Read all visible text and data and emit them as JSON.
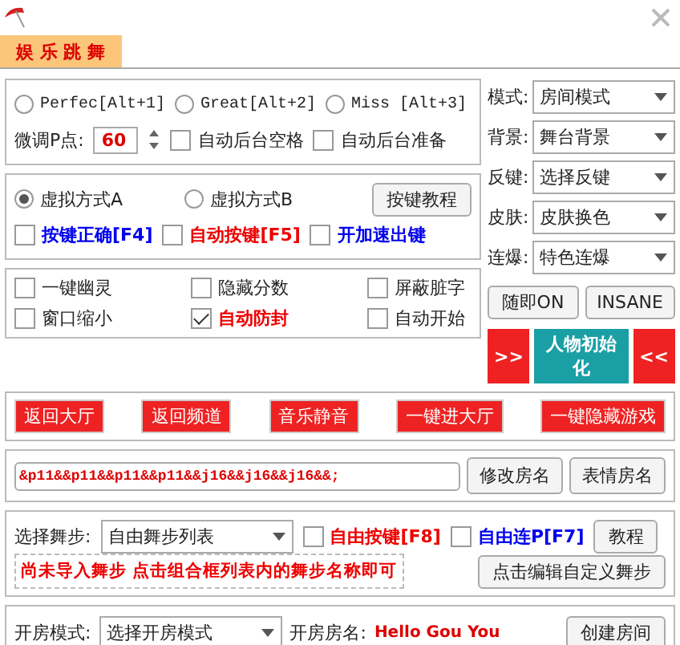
{
  "tab": {
    "label": "娱 乐 跳 舞",
    "selected": true
  },
  "judge": {
    "radios": [
      {
        "label": "Perfec[Alt+1]",
        "selected": false
      },
      {
        "label": "Great[Alt+2]",
        "selected": false
      },
      {
        "label": "Miss [Alt+3]",
        "selected": false
      }
    ],
    "fine_label": "微调P点:",
    "fine_value": "60",
    "checks": [
      {
        "label": "自动后台空格",
        "checked": false
      },
      {
        "label": "自动后台准备",
        "checked": false
      }
    ]
  },
  "virtual": {
    "radios": [
      {
        "label": "虚拟方式A",
        "selected": true
      },
      {
        "label": "虚拟方式B",
        "selected": false
      }
    ],
    "tutorial_button": "按键教程",
    "checks": [
      {
        "label": "按键正确[F4]",
        "checked": false,
        "color": "#0000ee"
      },
      {
        "label": "自动按键[F5]",
        "checked": false,
        "color": "#ee0000"
      },
      {
        "label": "开加速出键",
        "checked": false,
        "color": "#0000ee"
      }
    ]
  },
  "options": [
    {
      "label": "一键幽灵",
      "checked": false,
      "highlight": false
    },
    {
      "label": "隐藏分数",
      "checked": false,
      "highlight": false
    },
    {
      "label": "屏蔽脏字",
      "checked": false,
      "highlight": false
    },
    {
      "label": "窗口缩小",
      "checked": false,
      "highlight": false
    },
    {
      "label": "自动防封",
      "checked": true,
      "highlight": true
    },
    {
      "label": "自动开始",
      "checked": false,
      "highlight": false
    }
  ],
  "settings": [
    {
      "label": "模式:",
      "value": "房间模式"
    },
    {
      "label": "背景:",
      "value": "舞台背景"
    },
    {
      "label": "反键:",
      "value": "选择反键"
    },
    {
      "label": "皮肤:",
      "value": "皮肤换色"
    },
    {
      "label": "连爆:",
      "value": "特色连爆"
    }
  ],
  "side_buttons": [
    "随即ON",
    "INSANE"
  ],
  "character": {
    "prev": ">>",
    "label": "人物初始化",
    "next": "<<"
  },
  "quick_buttons": [
    "返回大厅",
    "返回频道",
    "音乐静音",
    "一键进大厅",
    "一键隐藏游戏"
  ],
  "room_name": {
    "value": "&p11&&p11&&p11&&p11&&j16&&j16&&j16&&;",
    "buttons": [
      "修改房名",
      "表情房名"
    ]
  },
  "dance": {
    "label": "选择舞步:",
    "select": "自由舞步列表",
    "checks": [
      {
        "label": "自由按键[F8]",
        "checked": false,
        "color": "#ee0000"
      },
      {
        "label": "自由连P[F7]",
        "checked": false,
        "color": "#0000ee"
      }
    ],
    "tutorial_button": "教程",
    "notice": "尚未导入舞步 点击组合框列表内的舞步名称即可",
    "edit_button": "点击编辑自定义舞步"
  },
  "open_room": {
    "mode_label": "开房模式:",
    "mode_select": "选择开房模式",
    "name_label": "开房房名:",
    "name_value": "Hello Gou You",
    "create_button": "创建房间"
  }
}
